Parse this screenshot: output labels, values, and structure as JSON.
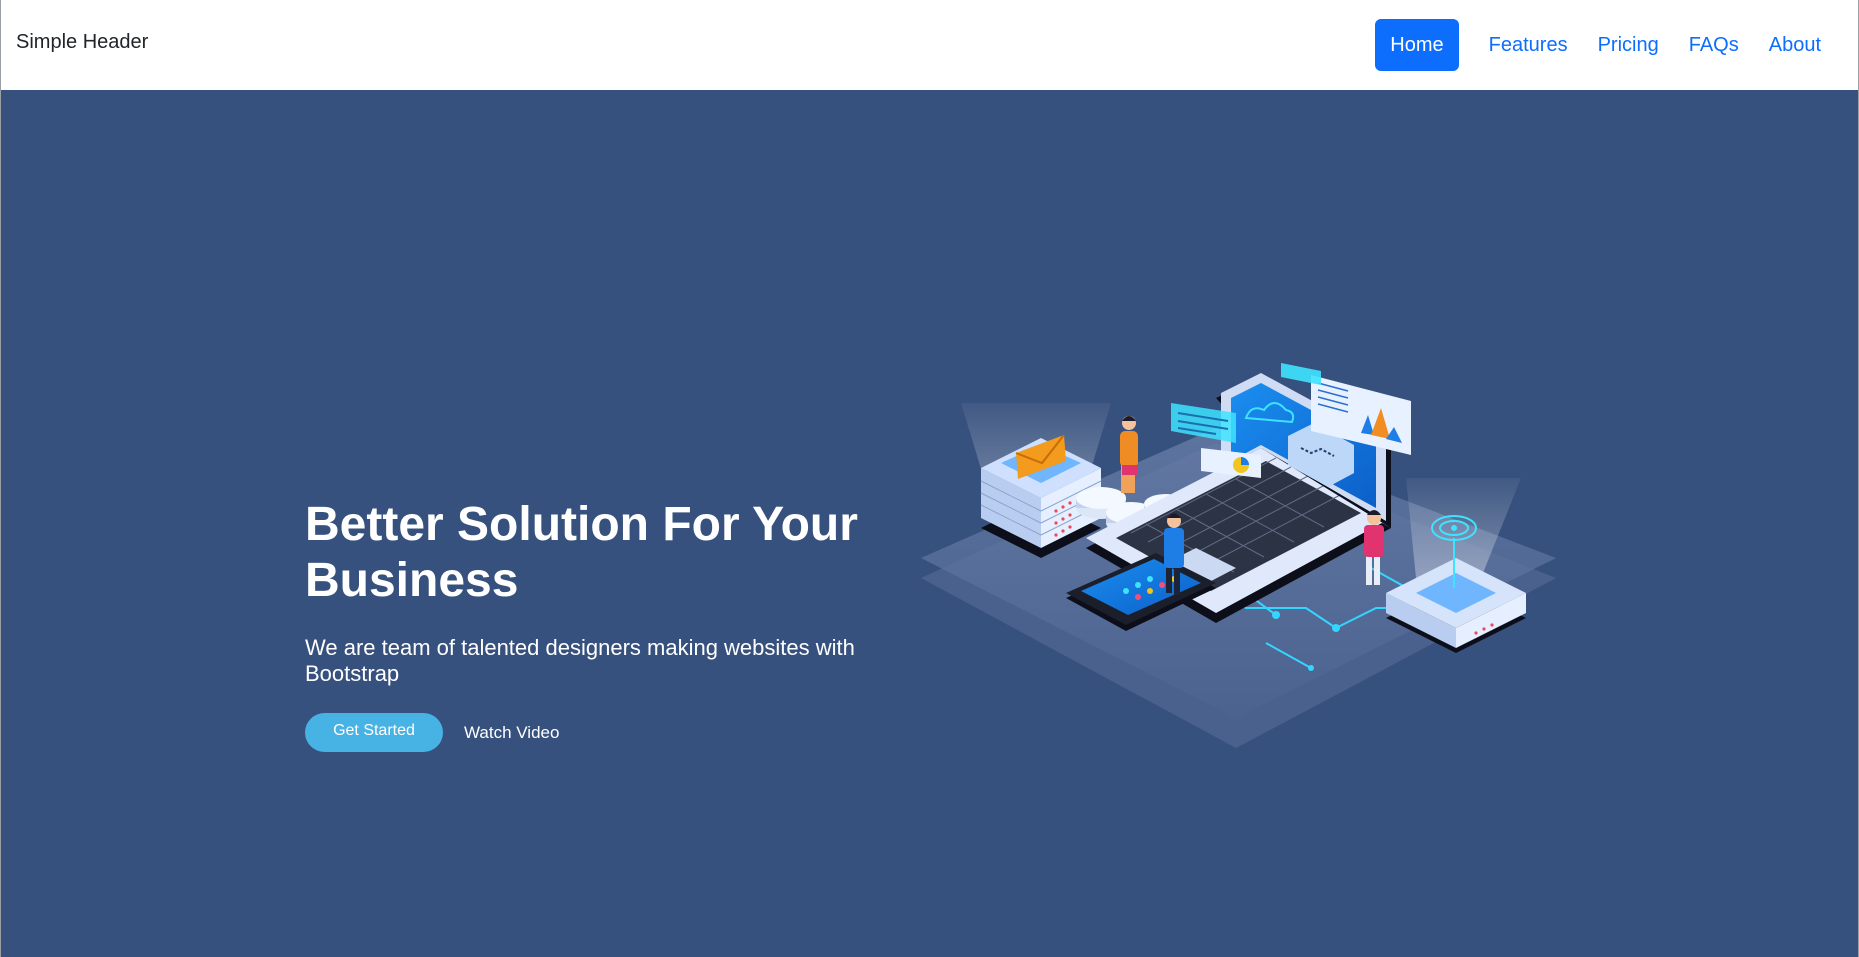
{
  "header": {
    "brand": "Simple Header",
    "nav": [
      {
        "label": "Home",
        "active": true
      },
      {
        "label": "Features"
      },
      {
        "label": "Pricing"
      },
      {
        "label": "FAQs"
      },
      {
        "label": "About"
      }
    ]
  },
  "hero": {
    "title": "Better Solution For Your Business",
    "subtitle": "We are team of talented designers making websites with Bootstrap",
    "primary_button": "Get Started",
    "secondary_link": "Watch Video",
    "illustration": "isometric-tech-illustration"
  },
  "colors": {
    "hero_bg": "#37517e",
    "accent": "#47b2e4",
    "nav_active": "#0d6efd",
    "nav_link": "#0d6efd"
  }
}
